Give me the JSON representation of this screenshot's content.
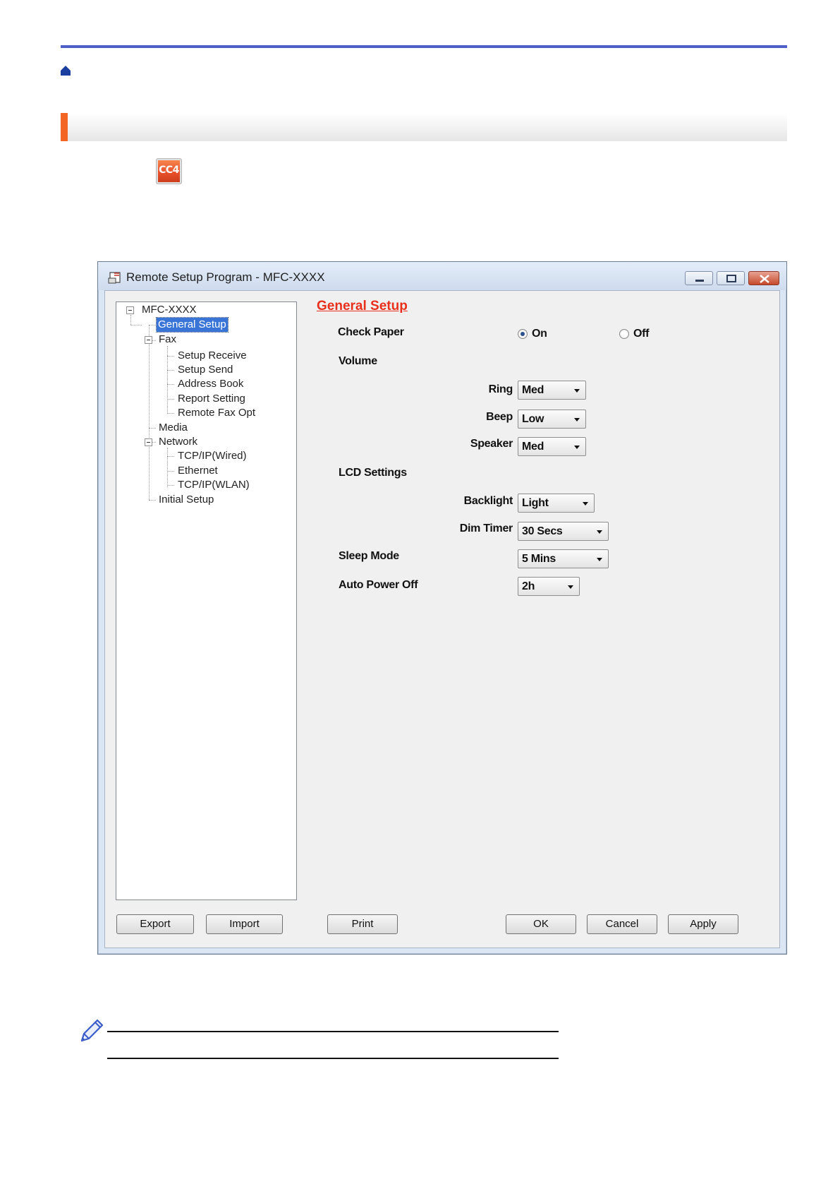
{
  "dialog": {
    "title": "Remote Setup Program - MFC-XXXX",
    "tree": {
      "root": "MFC-XXXX",
      "general_setup": "General Setup",
      "fax": "Fax",
      "setup_receive": "Setup Receive",
      "setup_send": "Setup Send",
      "address_book": "Address Book",
      "report_setting": "Report Setting",
      "remote_fax_opt": "Remote Fax Opt",
      "media": "Media",
      "network": "Network",
      "tcpip_wired": "TCP/IP(Wired)",
      "ethernet": "Ethernet",
      "tcpip_wlan": "TCP/IP(WLAN)",
      "initial_setup": "Initial Setup"
    },
    "panel": {
      "title": "General Setup",
      "check_paper": "Check Paper",
      "on_label": "On",
      "off_label": "Off",
      "volume": "Volume",
      "ring": "Ring",
      "ring_value": "Med",
      "beep": "Beep",
      "beep_value": "Low",
      "speaker": "Speaker",
      "speaker_value": "Med",
      "lcd_settings": "LCD Settings",
      "backlight": "Backlight",
      "backlight_value": "Light",
      "dim_timer": "Dim Timer",
      "dim_timer_value": "30 Secs",
      "sleep_mode": "Sleep Mode",
      "sleep_mode_value": "5 Mins",
      "auto_power_off": "Auto Power Off",
      "auto_power_off_value": "2h"
    },
    "buttons": {
      "export": "Export",
      "import": "Import",
      "print": "Print",
      "ok": "OK",
      "cancel": "Cancel",
      "apply": "Apply"
    }
  },
  "icons": {
    "app_icon_text": "CC4"
  },
  "colors": {
    "top_rule": "#4f5fc8",
    "section_accent": "#f26522",
    "panel_title": "#e8301c",
    "tree_selected": "#3875d7"
  }
}
